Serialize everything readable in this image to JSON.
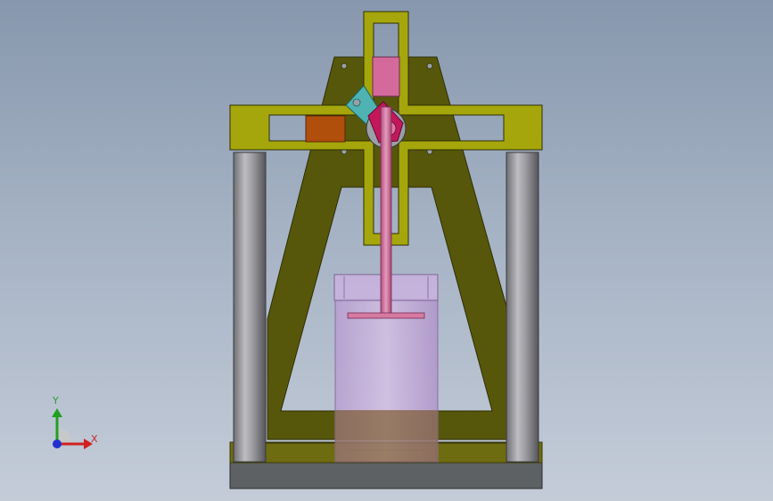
{
  "window": {
    "background_top": "#8797ad",
    "background_bottom": "#c4ccd8"
  },
  "model": {
    "name": "mechanism-assembly",
    "parts": [
      "base-plate",
      "left-guide-column",
      "right-guide-column",
      "triangular-frame",
      "crosshead-frame",
      "slider-block-top",
      "slider-block-left",
      "crank-disc",
      "connecting-arm",
      "piston-rod",
      "piston-plate",
      "transparent-cylinder",
      "cylinder-cap"
    ],
    "colors": {
      "frame": "#57570b",
      "crosshead": "#a5a60b",
      "columns": "#8f8f94",
      "base": "#5e6163",
      "rod": "#d47aa3",
      "slider_top": "#d46a9c",
      "slider_left": "#b04e0c",
      "crank": "#c2185b",
      "arm": "#4fb3b3",
      "cylinder": "#c9a9d9"
    }
  },
  "triad": {
    "icon": "coordinate-triad-icon",
    "x_label": "X",
    "y_label": "Y",
    "x_color": "#d02020",
    "y_color": "#20a020",
    "z_color": "#2030d0"
  }
}
